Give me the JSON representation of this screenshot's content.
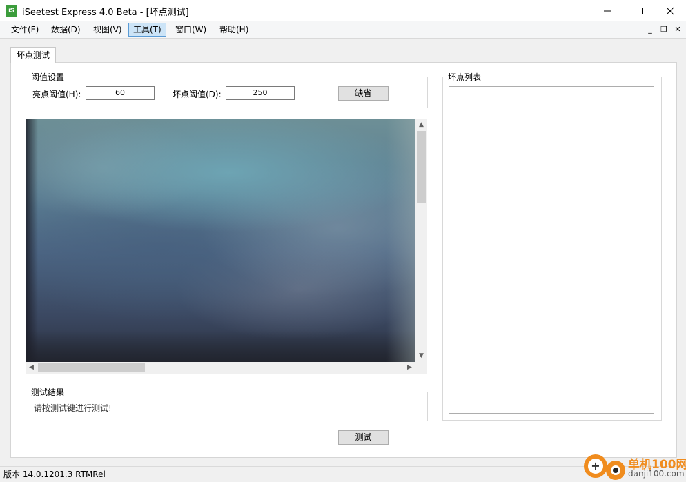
{
  "window": {
    "app_icon_text": "iS",
    "title": "iSeetest Express 4.0 Beta - [坏点测试]"
  },
  "menu": {
    "items": [
      {
        "label": "文件(F)"
      },
      {
        "label": "数据(D)"
      },
      {
        "label": "视图(V)"
      },
      {
        "label": "工具(T)",
        "active": true
      },
      {
        "label": "窗口(W)"
      },
      {
        "label": "帮助(H)"
      }
    ]
  },
  "tab": {
    "label": "坏点测试"
  },
  "threshold": {
    "group_title": "阈值设置",
    "bright_label": "亮点阈值(H):",
    "bright_value": "60",
    "bad_label": "坏点阈值(D):",
    "bad_value": "250",
    "default_button": "缺省"
  },
  "result": {
    "group_title": "测试结果",
    "message": "请按测试键进行测试!"
  },
  "test_button": "测试",
  "bad_list": {
    "group_title": "坏点列表"
  },
  "status": {
    "version": "版本 14.0.1201.3 RTMRel"
  },
  "watermark": {
    "brand": "单机100网",
    "url": "danji100.com"
  },
  "colors": {
    "accent_active_menu": "#cce4f7",
    "app_icon": "#3c9d3c",
    "watermark_orange": "#f08c1e"
  }
}
